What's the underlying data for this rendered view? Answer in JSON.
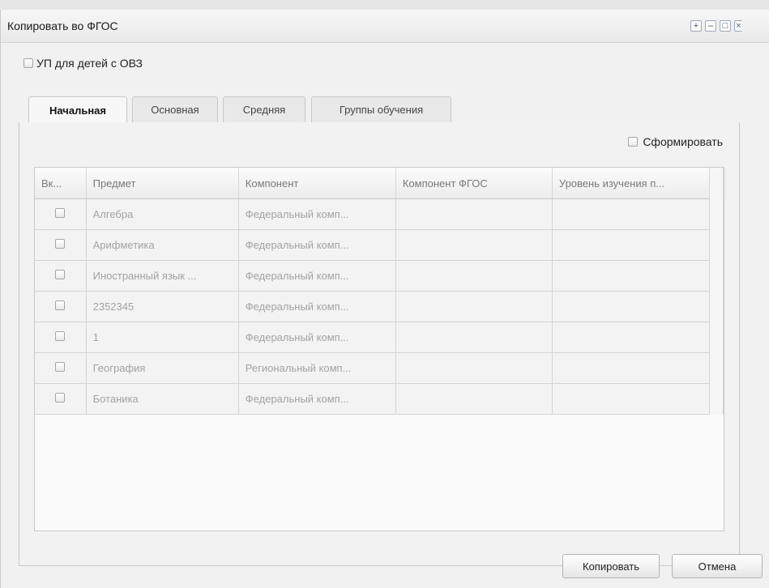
{
  "window": {
    "title": "Копировать во ФГОС"
  },
  "title_buttons": [
    {
      "name": "add-icon",
      "glyph": "+"
    },
    {
      "name": "minimize-icon",
      "glyph": "–"
    },
    {
      "name": "maximize-icon",
      "glyph": "□"
    }
  ],
  "ovz_checkbox": {
    "label": "УП для детей с ОВЗ"
  },
  "tabs": [
    {
      "label": "Начальная",
      "active": true
    },
    {
      "label": "Основная"
    },
    {
      "label": "Средняя"
    },
    {
      "label": "Группы обучения"
    }
  ],
  "form_checkbox": {
    "label": "Сформировать"
  },
  "grid": {
    "columns": [
      "Вк...",
      "Предмет",
      "Компонент",
      "Компонент ФГОС",
      "Уровень изучения п..."
    ],
    "rows": [
      {
        "subject": "Алгебра",
        "component": "Федеральный комп...",
        "fgos_component": "",
        "level": ""
      },
      {
        "subject": "Арифметика",
        "component": "Федеральный комп...",
        "fgos_component": "",
        "level": ""
      },
      {
        "subject": "Иностранный язык ...",
        "component": "Федеральный комп...",
        "fgos_component": "",
        "level": ""
      },
      {
        "subject": "2352345",
        "component": "Федеральный комп...",
        "fgos_component": "",
        "level": ""
      },
      {
        "subject": "1",
        "component": "Федеральный комп...",
        "fgos_component": "",
        "level": ""
      },
      {
        "subject": "География",
        "component": "Региональный комп...",
        "fgos_component": "",
        "level": ""
      },
      {
        "subject": "Ботаника",
        "component": "Федеральный комп...",
        "fgos_component": "",
        "level": ""
      }
    ]
  },
  "buttons": {
    "copy": "Копировать",
    "cancel": "Отмена"
  }
}
